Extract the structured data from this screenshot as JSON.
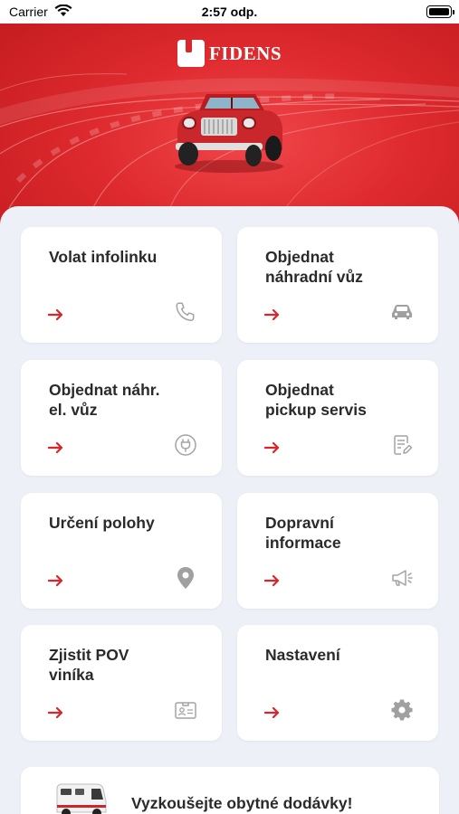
{
  "status_bar": {
    "carrier": "Carrier",
    "time": "2:57 odp."
  },
  "header": {
    "brand": "FIDENS",
    "accent_color": "#d8262a"
  },
  "tiles": [
    {
      "label": "Volat infolinku",
      "icon": "phone-icon"
    },
    {
      "label": "Objednat\nnáhradní vůz",
      "icon": "car-icon"
    },
    {
      "label": "Objednat náhr.\nel. vůz",
      "icon": "ev-plug-icon"
    },
    {
      "label": "Objednat\npickup servis",
      "icon": "document-edit-icon"
    },
    {
      "label": "Určení polohy",
      "icon": "location-pin-icon"
    },
    {
      "label": "Dopravní\ninformace",
      "icon": "megaphone-icon"
    },
    {
      "label": "Zjistit POV\nviníka",
      "icon": "id-card-icon"
    },
    {
      "label": "Nastavení",
      "icon": "gear-icon"
    }
  ],
  "promo": {
    "label": "Vyzkoušejte obytné dodávky!",
    "icon": "camper-van-image"
  }
}
